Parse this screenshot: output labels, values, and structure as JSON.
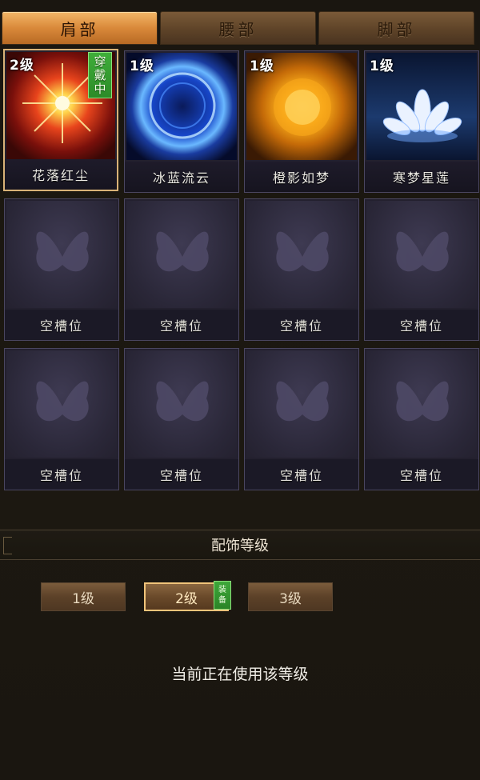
{
  "tabs": [
    {
      "label": "肩部",
      "active": true
    },
    {
      "label": "腰部",
      "active": false
    },
    {
      "label": "脚部",
      "active": false
    }
  ],
  "cards": [
    {
      "level": "2级",
      "name": "花落红尘",
      "worn": true,
      "art": "red-burst",
      "selected": true
    },
    {
      "level": "1级",
      "name": "冰蓝流云",
      "worn": false,
      "art": "blue-vortex",
      "selected": false
    },
    {
      "level": "1级",
      "name": "橙影如梦",
      "worn": false,
      "art": "orange-sun",
      "selected": false
    },
    {
      "level": "1级",
      "name": "寒梦星莲",
      "worn": false,
      "art": "white-lotus",
      "selected": false
    }
  ],
  "worn_badge": [
    "穿",
    "戴",
    "中"
  ],
  "empty_slot_label": "空槽位",
  "empty_slots": 8,
  "section_title": "配饰等级",
  "level_buttons": [
    {
      "label": "1级",
      "active": false
    },
    {
      "label": "2级",
      "active": true,
      "equipped": true
    },
    {
      "label": "3级",
      "active": false
    }
  ],
  "equip_badge": [
    "装",
    "备"
  ],
  "status_text": "当前正在使用该等级",
  "colors": {
    "tab_active": "#d9893a",
    "tab_inactive": "#5e4328",
    "selected_border": "#d9b277",
    "badge_green": "#2c8b28",
    "background": "#1b1710"
  }
}
